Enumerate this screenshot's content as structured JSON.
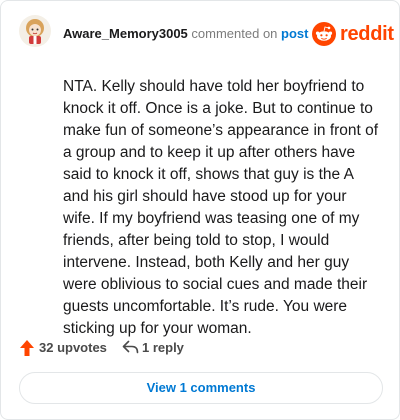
{
  "comment": {
    "username": "Aware_Memory3005",
    "action_text": "commented on",
    "post_link": "post",
    "body": "NTA. Kelly should have told her boyfriend to knock it off. Once is a joke. But to continue to make fun of someone’s appearance in front of a group and to keep it up after others have said to knock it off, shows that guy is the A and his girl should have stood up for your wife. If my boyfriend was teasing one of my friends, after being told to stop, I would intervene. Instead, both Kelly and her guy were oblivious to social cues and made their guests uncomfortable. It’s rude. You were sticking up for your woman."
  },
  "brand": {
    "name": "reddit",
    "icon": "reddit-logo-icon",
    "color": "#ff4500"
  },
  "actions": {
    "upvotes": "32 upvotes",
    "upvote_icon": "upvote-arrow-icon",
    "upvote_color": "#ff4500",
    "replies": "1 reply",
    "reply_icon": "reply-arrow-icon"
  },
  "view_button": {
    "label": "View 1 comments",
    "color": "#0079d3"
  }
}
